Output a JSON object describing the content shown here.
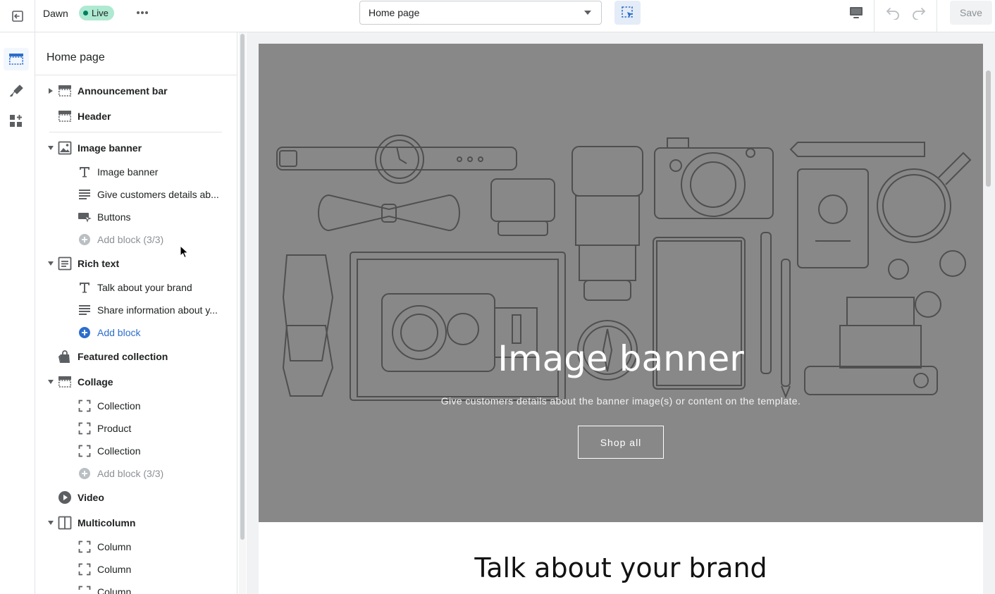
{
  "topbar": {
    "theme_name": "Dawn",
    "status_badge": "Live",
    "page_selector_value": "Home page",
    "save_label": "Save"
  },
  "rail": {
    "items": [
      "sections-icon",
      "theme-settings-icon",
      "app-embeds-icon"
    ]
  },
  "sidebar": {
    "title": "Home page",
    "items": [
      {
        "label": "Announcement bar",
        "type": "section",
        "icon": "layout-header-icon",
        "toggle": "collapsed"
      },
      {
        "label": "Header",
        "type": "section",
        "icon": "layout-header-icon"
      },
      {
        "label": "Image banner",
        "type": "section",
        "icon": "image-icon",
        "toggle": "expanded"
      },
      {
        "label": "Image banner",
        "type": "block",
        "icon": "text-icon"
      },
      {
        "label": "Give customers details ab...",
        "type": "block",
        "icon": "text-align-icon"
      },
      {
        "label": "Buttons",
        "type": "block",
        "icon": "button-icon"
      },
      {
        "label": "Add block (3/3)",
        "type": "add-disabled",
        "icon": "add-circle-icon"
      },
      {
        "label": "Rich text",
        "type": "section",
        "icon": "text-block-icon",
        "toggle": "expanded"
      },
      {
        "label": "Talk about your brand",
        "type": "block",
        "icon": "text-icon"
      },
      {
        "label": "Share information about y...",
        "type": "block",
        "icon": "text-align-icon"
      },
      {
        "label": "Add block",
        "type": "add",
        "icon": "add-circle-icon"
      },
      {
        "label": "Featured collection",
        "type": "section",
        "icon": "shopping-bag-icon"
      },
      {
        "label": "Collage",
        "type": "section",
        "icon": "layout-header-icon",
        "toggle": "expanded"
      },
      {
        "label": "Collection",
        "type": "block",
        "icon": "frame-icon"
      },
      {
        "label": "Product",
        "type": "block",
        "icon": "frame-icon"
      },
      {
        "label": "Collection",
        "type": "block",
        "icon": "frame-icon"
      },
      {
        "label": "Add block (3/3)",
        "type": "add-disabled",
        "icon": "add-circle-icon"
      },
      {
        "label": "Video",
        "type": "section",
        "icon": "play-icon"
      },
      {
        "label": "Multicolumn",
        "type": "section",
        "icon": "columns-icon",
        "toggle": "expanded"
      },
      {
        "label": "Column",
        "type": "block",
        "icon": "frame-icon"
      },
      {
        "label": "Column",
        "type": "block",
        "icon": "frame-icon"
      },
      {
        "label": "Column",
        "type": "block",
        "icon": "frame-icon"
      }
    ]
  },
  "preview": {
    "banner_heading": "Image banner",
    "banner_text": "Give customers details about the banner image(s) or content on the template.",
    "banner_button": "Shop all",
    "rich_text_heading": "Talk about your brand"
  },
  "colors": {
    "accent": "#2c6ecb",
    "live_badge": "#aee9d1",
    "banner_overlay": "#888888"
  }
}
